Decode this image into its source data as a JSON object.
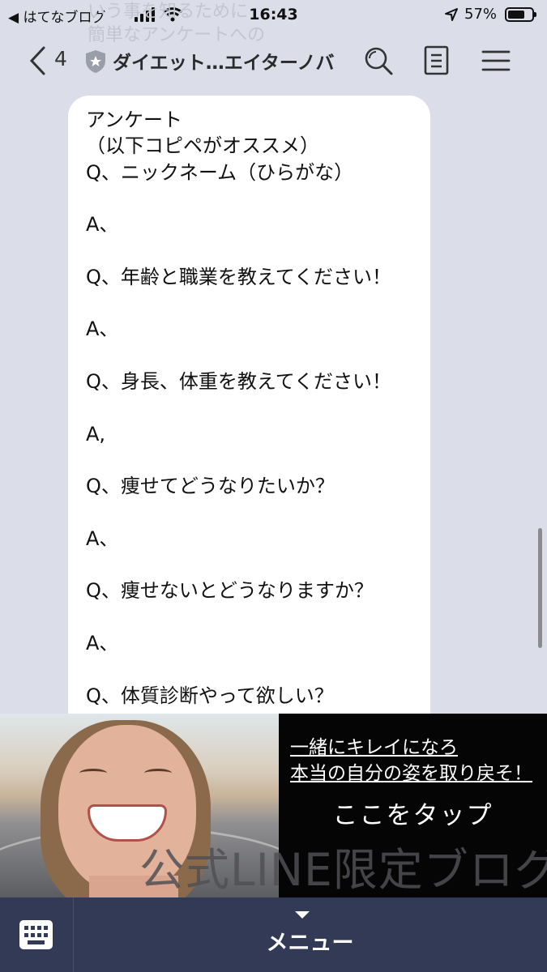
{
  "status_bar": {
    "back_app": "◀ はてなブログ",
    "time": "16:43",
    "battery": "57%",
    "battery_level": 0.57,
    "signal_bars": 4
  },
  "ghost_text": [
    "いう事を知るために",
    "簡単なアンケートへの"
  ],
  "header": {
    "unread_count": "4",
    "title": "ダイエット…エイターノバ",
    "icons": [
      "back-chevron-icon",
      "shield-icon",
      "search-icon",
      "note-icon",
      "hamburger-icon"
    ]
  },
  "message": {
    "lines": [
      "アンケート",
      "（以下コピペがオススメ）",
      "Q、ニックネーム（ひらがな）",
      "",
      "A、",
      "",
      "Q、年齢と職業を教えてください！",
      "",
      "A、",
      "",
      "Q、身長、体重を教えてください！",
      "",
      "A,",
      "",
      "Q、痩せてどうなりたいか？",
      "",
      "A、",
      "",
      "Q、痩せないとどうなりますか？",
      "",
      "A、",
      "",
      "Q、体質診断やって欲しい？"
    ]
  },
  "banner": {
    "tagline1": "一緒にキレイになろ",
    "tagline2": "本当の自分の姿を取り戻そ！",
    "cta": "ここをタップ",
    "overlay": "公式LINE限定ブログ"
  },
  "bottom_bar": {
    "menu_label": "メニュー",
    "keyboard_icon": "keyboard-icon"
  },
  "colors": {
    "chat_background": "#dbdee9",
    "bubble": "#ffffff",
    "bottom_bar": "#323a55",
    "banner_background": "#050505"
  }
}
